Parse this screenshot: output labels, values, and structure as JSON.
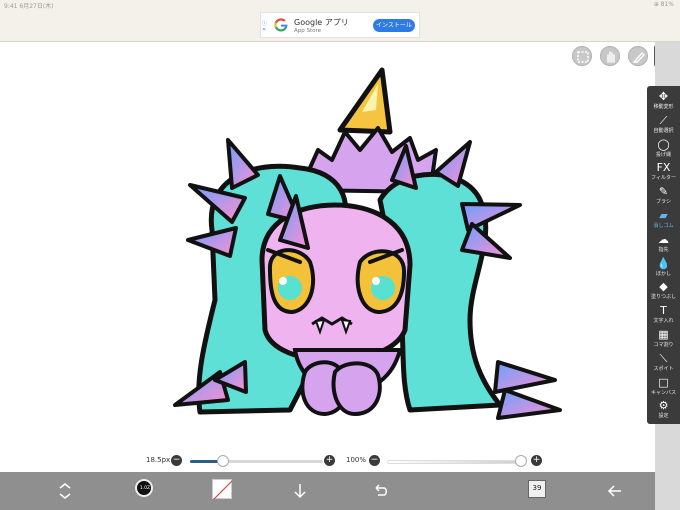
{
  "status": {
    "left": "9:41  6月27日(木)",
    "right": "⊕ 81%"
  },
  "ad": {
    "title": "Google アプリ",
    "subtitle": "App Store",
    "install_label": "インストール",
    "ad_marks": "ⓘ ✕"
  },
  "tools": [
    {
      "icon": "✥",
      "label": "移動変形",
      "name": "move-transform-tool"
    },
    {
      "icon": "⟋",
      "label": "自動選択",
      "name": "auto-select-tool"
    },
    {
      "icon": "◯",
      "label": "投げ縄",
      "name": "lasso-tool"
    },
    {
      "icon": "FX",
      "label": "フィルター",
      "name": "filter-tool"
    },
    {
      "icon": "✎",
      "label": "ブラシ",
      "name": "brush-tool"
    },
    {
      "icon": "▰",
      "label": "消しゴム",
      "name": "eraser-tool",
      "active": true
    },
    {
      "icon": "☁",
      "label": "指先",
      "name": "smudge-tool"
    },
    {
      "icon": "💧",
      "label": "ぼかし",
      "name": "blur-tool"
    },
    {
      "icon": "◆",
      "label": "塗りつぶし",
      "name": "fill-tool"
    },
    {
      "icon": "T",
      "label": "文字入れ",
      "name": "text-tool"
    },
    {
      "icon": "▦",
      "label": "コマ割り",
      "name": "frame-divider-tool"
    },
    {
      "icon": "⟍",
      "label": "スポイト",
      "name": "eyedropper-tool"
    },
    {
      "icon": "□",
      "label": "キャンバス",
      "name": "canvas-tool"
    },
    {
      "icon": "⚙",
      "label": "設定",
      "name": "settings-tool"
    }
  ],
  "brush_size": {
    "label": "18.5px",
    "value_fraction": 0.25
  },
  "opacity": {
    "label": "100%",
    "value_fraction": 1.0
  },
  "bottom": {
    "brush_badge": "1.0Z",
    "layer_count": "39",
    "colors": {
      "bar": "#8f8f8f",
      "accent": "#5fb6f0"
    }
  },
  "icons": [
    "selection-circle-icon",
    "hand-icon",
    "pen-icon",
    "image-icon",
    "rotate-icon",
    "undo-icon",
    "arrow-left-icon",
    "arrow-down-icon"
  ]
}
